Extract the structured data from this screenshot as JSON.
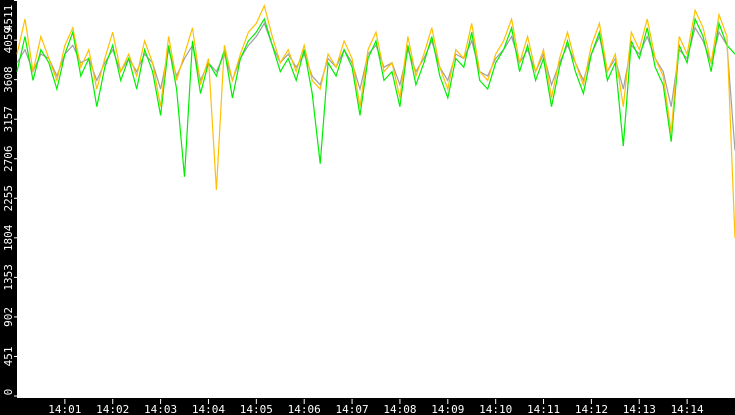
{
  "chart_data": {
    "type": "line",
    "title": "",
    "xlabel": "",
    "ylabel": "",
    "ylim": [
      0,
      4511
    ],
    "y_ticks": [
      "0",
      "451",
      "902",
      "1353",
      "1804",
      "2255",
      "2706",
      "3157",
      "3608",
      "4059",
      "4511"
    ],
    "x_ticks": [
      "14:01",
      "14:02",
      "14:03",
      "14:04",
      "14:05",
      "14:06",
      "14:07",
      "14:08",
      "14:09",
      "14:10",
      "14:11",
      "14:12",
      "14:13",
      "14:14"
    ],
    "x_range_minutes": [
      0,
      15
    ],
    "x_tick_minutes": [
      1,
      2,
      3,
      4,
      5,
      6,
      7,
      8,
      9,
      10,
      11,
      12,
      13,
      14
    ],
    "sample_interval_seconds": 10,
    "series": [
      {
        "name": "gray",
        "color": "#a0a0a0",
        "values": [
          3800,
          3950,
          3700,
          3900,
          3850,
          3650,
          3900,
          4000,
          3800,
          3850,
          3600,
          3800,
          3950,
          3700,
          3850,
          3700,
          3900,
          3800,
          3500,
          3950,
          3650,
          3850,
          4000,
          3600,
          3800,
          3700,
          3900,
          3600,
          3850,
          4000,
          4100,
          4250,
          4000,
          3800,
          3900,
          3750,
          3900,
          3650,
          3550,
          3850,
          3750,
          3950,
          3800,
          3500,
          3900,
          4000,
          3750,
          3800,
          3550,
          3950,
          3700,
          3850,
          4050,
          3750,
          3600,
          3900,
          3850,
          4050,
          3700,
          3650,
          3850,
          3950,
          4100,
          3800,
          3950,
          3700,
          3900,
          3550,
          3800,
          4000,
          3800,
          3600,
          3900,
          4100,
          3700,
          3850,
          3500,
          4000,
          3900,
          4100,
          3850,
          3700,
          3300,
          3950,
          3850,
          4200,
          4050,
          3800,
          4150,
          4000,
          2800
        ]
      },
      {
        "name": "green",
        "color": "#00ee00",
        "values": [
          3700,
          4100,
          3600,
          3950,
          3800,
          3500,
          3900,
          4150,
          3650,
          3850,
          3300,
          3750,
          4000,
          3600,
          3850,
          3500,
          3950,
          3700,
          3200,
          4000,
          3500,
          2500,
          4050,
          3450,
          3800,
          3650,
          3950,
          3400,
          3850,
          4050,
          4150,
          4300,
          4000,
          3700,
          3850,
          3600,
          3950,
          3450,
          2650,
          3800,
          3650,
          3950,
          3750,
          3200,
          3850,
          4050,
          3600,
          3700,
          3300,
          4000,
          3550,
          3800,
          4100,
          3650,
          3400,
          3850,
          3750,
          4150,
          3600,
          3500,
          3800,
          3950,
          4200,
          3700,
          4000,
          3600,
          3850,
          3300,
          3750,
          4050,
          3700,
          3450,
          3900,
          4150,
          3600,
          3800,
          2850,
          4050,
          3850,
          4200,
          3750,
          3550,
          2900,
          4000,
          3800,
          4300,
          4100,
          3700,
          4250,
          4000,
          3900
        ]
      },
      {
        "name": "yellow",
        "color": "#ffc000",
        "values": [
          3900,
          4300,
          3700,
          4100,
          3850,
          3600,
          4000,
          4200,
          3750,
          3950,
          3500,
          3850,
          4150,
          3700,
          3900,
          3650,
          4050,
          3800,
          3300,
          4100,
          3600,
          3900,
          4200,
          3550,
          3850,
          2350,
          4000,
          3600,
          3900,
          4150,
          4250,
          4450,
          4100,
          3800,
          3950,
          3700,
          4000,
          3600,
          3500,
          3900,
          3750,
          4050,
          3850,
          3300,
          3950,
          4150,
          3700,
          3800,
          3400,
          4100,
          3650,
          3900,
          4200,
          3750,
          3500,
          3950,
          3850,
          4250,
          3700,
          3600,
          3900,
          4050,
          4300,
          3800,
          4100,
          3700,
          3950,
          3400,
          3850,
          4150,
          3800,
          3550,
          4000,
          4250,
          3700,
          3900,
          3300,
          4150,
          3950,
          4300,
          3850,
          3650,
          3000,
          4100,
          3900,
          4400,
          4200,
          3800,
          4350,
          4100,
          1800
        ]
      }
    ]
  }
}
